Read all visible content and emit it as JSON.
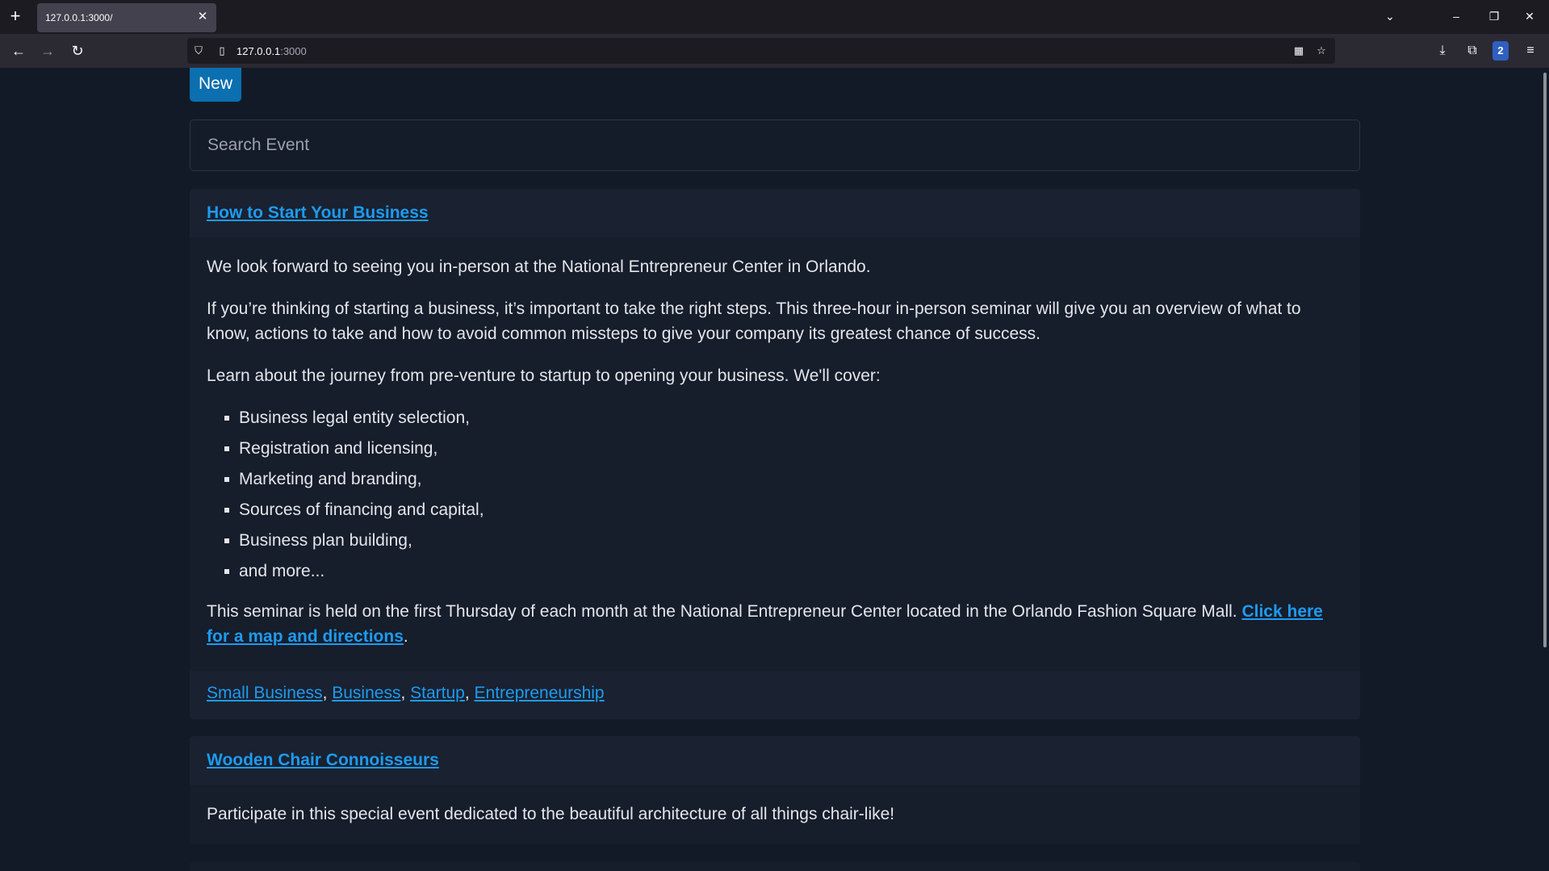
{
  "browser": {
    "tab_title": "127.0.0.1:3000/",
    "url_host": "127.0.0.1",
    "url_port": ":3000",
    "ext_badge": "2",
    "icons": {
      "new_tab": "+",
      "tab_close": "✕",
      "tabs_list": "⌄",
      "minimize": "–",
      "restore": "❐",
      "close": "✕",
      "back": "←",
      "forward": "→",
      "reload": "↻",
      "shield": "⛉",
      "page": "▯",
      "qr": "▦",
      "star": "☆",
      "download": "⤓",
      "extensions": "⧉",
      "menu": "≡"
    }
  },
  "page": {
    "new_button": "New",
    "search_placeholder": "Search Event",
    "events": [
      {
        "title": "How to Start Your Business",
        "paragraphs": [
          "We look forward to seeing you in-person at the National Entrepreneur Center in Orlando.",
          "If you’re thinking of starting a business, it’s important to take the right steps. This three-hour in-person seminar will give you an overview of what to know, actions to take and how to avoid common missteps to give your company its greatest chance of success.",
          "Learn about the journey from pre-venture to startup to opening your business. We'll cover:"
        ],
        "list": [
          "Business legal entity selection,",
          "Registration and licensing,",
          "Marketing and branding,",
          "Sources of financing and capital,",
          "Business plan building,",
          "and more..."
        ],
        "closing_text": "This seminar is held on the first Thursday of each month at the National Entrepreneur Center located in the Orlando Fashion Square Mall. ",
        "closing_link": "Click here for a map and directions",
        "closing_end": ".",
        "tags": [
          "Small Business",
          "Business",
          "Startup",
          "Entrepreneurship"
        ],
        "tag_sep": ", "
      },
      {
        "title": "Wooden Chair Connoisseurs",
        "paragraphs": [
          "Participate in this special event dedicated to the beautiful architecture of all things chair-like!"
        ]
      }
    ]
  }
}
